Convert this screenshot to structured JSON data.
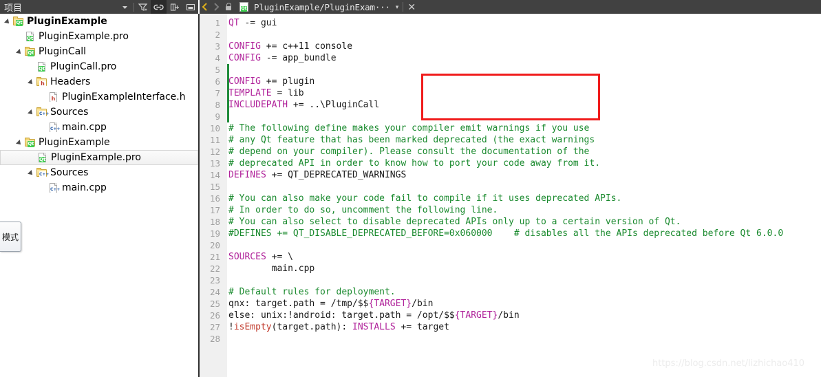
{
  "sidebar": {
    "title": "项目",
    "toolbar": [
      {
        "name": "filter-dropdown-caret-icon",
        "glyph": "▾",
        "active": false
      },
      {
        "name": "filter-icon",
        "glyph": "",
        "active": false
      },
      {
        "name": "link-sync-icon",
        "glyph": "",
        "active": true
      },
      {
        "name": "split-add-icon",
        "glyph": "",
        "active": false
      },
      {
        "name": "minimize-panel-icon",
        "glyph": "",
        "active": false
      }
    ],
    "tree": [
      {
        "label": "PluginExample",
        "icon": "qt-folder-icon",
        "depth": 0,
        "arrow": true,
        "bold": true,
        "selected": false
      },
      {
        "label": "PluginExample.pro",
        "icon": "qt-file-icon",
        "depth": 1,
        "arrow": false,
        "bold": false,
        "selected": false
      },
      {
        "label": "PluginCall",
        "icon": "qt-folder-icon",
        "depth": 1,
        "arrow": true,
        "bold": false,
        "selected": false
      },
      {
        "label": "PluginCall.pro",
        "icon": "qt-file-icon",
        "depth": 2,
        "arrow": false,
        "bold": false,
        "selected": false
      },
      {
        "label": "Headers",
        "icon": "h-folder-icon",
        "depth": 2,
        "arrow": true,
        "bold": false,
        "selected": false
      },
      {
        "label": "PluginExampleInterface.h",
        "icon": "h-file-icon",
        "depth": 3,
        "arrow": false,
        "bold": false,
        "selected": false
      },
      {
        "label": "Sources",
        "icon": "cpp-folder-icon",
        "depth": 2,
        "arrow": true,
        "bold": false,
        "selected": false
      },
      {
        "label": "main.cpp",
        "icon": "cpp-file-icon",
        "depth": 3,
        "arrow": false,
        "bold": false,
        "selected": false
      },
      {
        "label": "PluginExample",
        "icon": "qt-folder-icon",
        "depth": 1,
        "arrow": true,
        "bold": false,
        "selected": false
      },
      {
        "label": "PluginExample.pro",
        "icon": "qt-file-icon",
        "depth": 2,
        "arrow": false,
        "bold": false,
        "selected": true
      },
      {
        "label": "Sources",
        "icon": "cpp-folder-icon",
        "depth": 2,
        "arrow": true,
        "bold": false,
        "selected": false
      },
      {
        "label": "main.cpp",
        "icon": "cpp-file-icon",
        "depth": 3,
        "arrow": false,
        "bold": false,
        "selected": false
      }
    ]
  },
  "mode_tab": {
    "label": "模式"
  },
  "editor": {
    "tabbar": {
      "back_glyph": "‹",
      "forward_glyph": "›",
      "lock_icon": "lock-open-icon",
      "file_icon": "qt-file-icon",
      "title": "PluginExample/PluginExam···",
      "caret": "▾",
      "close": "✕"
    },
    "first_line": 1,
    "last_line": 28,
    "change_bar": {
      "from_line": 5,
      "to_line": 9,
      "color": "#1f8b3a"
    },
    "annotation_box": {
      "color": "#f01c1c",
      "lines": [
        6,
        8
      ]
    },
    "lines": [
      {
        "n": 1,
        "tokens": [
          {
            "t": "QT ",
            "c": "kw"
          },
          {
            "t": "-= gui",
            "c": "pl"
          }
        ]
      },
      {
        "n": 2,
        "tokens": []
      },
      {
        "n": 3,
        "tokens": [
          {
            "t": "CONFIG ",
            "c": "kw"
          },
          {
            "t": "+= c++11 console",
            "c": "pl"
          }
        ]
      },
      {
        "n": 4,
        "tokens": [
          {
            "t": "CONFIG ",
            "c": "kw"
          },
          {
            "t": "-= app_bundle",
            "c": "pl"
          }
        ]
      },
      {
        "n": 5,
        "tokens": []
      },
      {
        "n": 6,
        "tokens": [
          {
            "t": "CONFIG ",
            "c": "kw"
          },
          {
            "t": "+= plugin",
            "c": "pl"
          }
        ]
      },
      {
        "n": 7,
        "tokens": [
          {
            "t": "TEMPLATE ",
            "c": "kw"
          },
          {
            "t": "= lib",
            "c": "pl"
          }
        ]
      },
      {
        "n": 8,
        "tokens": [
          {
            "t": "INCLUDEPATH ",
            "c": "kw"
          },
          {
            "t": "+= ..\\PluginCall",
            "c": "pl"
          }
        ]
      },
      {
        "n": 9,
        "tokens": []
      },
      {
        "n": 10,
        "tokens": [
          {
            "t": "# The following define makes your compiler emit warnings if you use",
            "c": "cm"
          }
        ]
      },
      {
        "n": 11,
        "tokens": [
          {
            "t": "# any Qt feature that has been marked deprecated (the exact warnings",
            "c": "cm"
          }
        ]
      },
      {
        "n": 12,
        "tokens": [
          {
            "t": "# depend on your compiler). Please consult the documentation of the",
            "c": "cm"
          }
        ]
      },
      {
        "n": 13,
        "tokens": [
          {
            "t": "# deprecated API in order to know how to port your code away from it.",
            "c": "cm"
          }
        ]
      },
      {
        "n": 14,
        "tokens": [
          {
            "t": "DEFINES ",
            "c": "kw"
          },
          {
            "t": "+= QT_DEPRECATED_WARNINGS",
            "c": "pl"
          }
        ]
      },
      {
        "n": 15,
        "tokens": []
      },
      {
        "n": 16,
        "tokens": [
          {
            "t": "# You can also make your code fail to compile if it uses deprecated APIs.",
            "c": "cm"
          }
        ]
      },
      {
        "n": 17,
        "tokens": [
          {
            "t": "# In order to do so, uncomment the following line.",
            "c": "cm"
          }
        ]
      },
      {
        "n": 18,
        "tokens": [
          {
            "t": "# You can also select to disable deprecated APIs only up to a certain version of Qt.",
            "c": "cm"
          }
        ]
      },
      {
        "n": 19,
        "tokens": [
          {
            "t": "#DEFINES += QT_DISABLE_DEPRECATED_BEFORE=0x060000    # disables all the APIs deprecated before Qt 6.0.0",
            "c": "cm"
          }
        ]
      },
      {
        "n": 20,
        "tokens": []
      },
      {
        "n": 21,
        "tokens": [
          {
            "t": "SOURCES ",
            "c": "kw"
          },
          {
            "t": "+= \\",
            "c": "pl"
          }
        ]
      },
      {
        "n": 22,
        "tokens": [
          {
            "t": "        main.cpp",
            "c": "pl"
          }
        ]
      },
      {
        "n": 23,
        "tokens": []
      },
      {
        "n": 24,
        "tokens": [
          {
            "t": "# Default rules for deployment.",
            "c": "cm"
          }
        ]
      },
      {
        "n": 25,
        "tokens": [
          {
            "t": "qnx: target.path = /tmp/$$",
            "c": "pl"
          },
          {
            "t": "{TARGET}",
            "c": "kw"
          },
          {
            "t": "/bin",
            "c": "pl"
          }
        ]
      },
      {
        "n": 26,
        "tokens": [
          {
            "t": "else: unix:!android: target.path = /opt/$$",
            "c": "pl"
          },
          {
            "t": "{TARGET}",
            "c": "kw"
          },
          {
            "t": "/bin",
            "c": "pl"
          }
        ]
      },
      {
        "n": 27,
        "tokens": [
          {
            "t": "!",
            "c": "pl"
          },
          {
            "t": "isEmpty",
            "c": "fn"
          },
          {
            "t": "(target.path): ",
            "c": "pl"
          },
          {
            "t": "INSTALLS ",
            "c": "kw"
          },
          {
            "t": "+= target",
            "c": "pl"
          }
        ]
      },
      {
        "n": 28,
        "tokens": []
      }
    ]
  },
  "watermark": {
    "text": "https://blog.csdn.net/lizhichao410"
  },
  "colors": {
    "toolbar_bg": "#414141",
    "keyword": "#b0229a",
    "comment": "#1a8a2e",
    "function": "#c0392b",
    "annotation": "#f01c1c",
    "changebar": "#1f8b3a",
    "gutter_bg": "#f0f0f0"
  }
}
